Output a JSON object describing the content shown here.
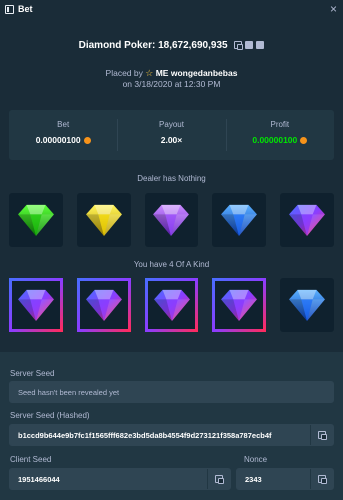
{
  "window": {
    "title": "Bet",
    "close_label": "×"
  },
  "bet": {
    "headline": "Diamond Poker: 18,672,690,935",
    "placed_prefix": "Placed by",
    "username": "ME wongedanbebas",
    "placed_date": "on 3/18/2020 at 12:30 PM"
  },
  "stats": {
    "bet_label": "Bet",
    "bet_value": "0.00000100",
    "payout_label": "Payout",
    "payout_value": "2.00×",
    "profit_label": "Profit",
    "profit_value": "0.00000100"
  },
  "dealer": {
    "label": "Dealer has Nothing",
    "gems": [
      "green",
      "yellow",
      "purple",
      "blue",
      "red-blue"
    ]
  },
  "player": {
    "label": "You have 4 Of A Kind",
    "gems": [
      "red-blue",
      "red-blue",
      "red-blue",
      "red-blue",
      "blue"
    ],
    "winning": [
      true,
      true,
      true,
      true,
      false
    ]
  },
  "seeds": {
    "server_seed_label": "Server Seed",
    "server_seed_placeholder": "Seed hasn't been revealed yet",
    "hashed_label": "Server Seed (Hashed)",
    "hashed_value": "b1ccd9b644e9b7fc1f1565fff682e3bd5da8b4554f9d273121f358a787ecb4f",
    "client_label": "Client Seed",
    "client_value": "1951466044",
    "nonce_label": "Nonce",
    "nonce_value": "2343"
  },
  "colors": {
    "bg": "#1a2c38",
    "panel": "#213743",
    "profit_green": "#00e701",
    "coin": "#f7931a"
  },
  "icons": [
    "window-icon",
    "close-icon",
    "copy-icon",
    "facebook-icon",
    "twitter-icon",
    "vip-star-icon",
    "btc-coin-icon"
  ]
}
